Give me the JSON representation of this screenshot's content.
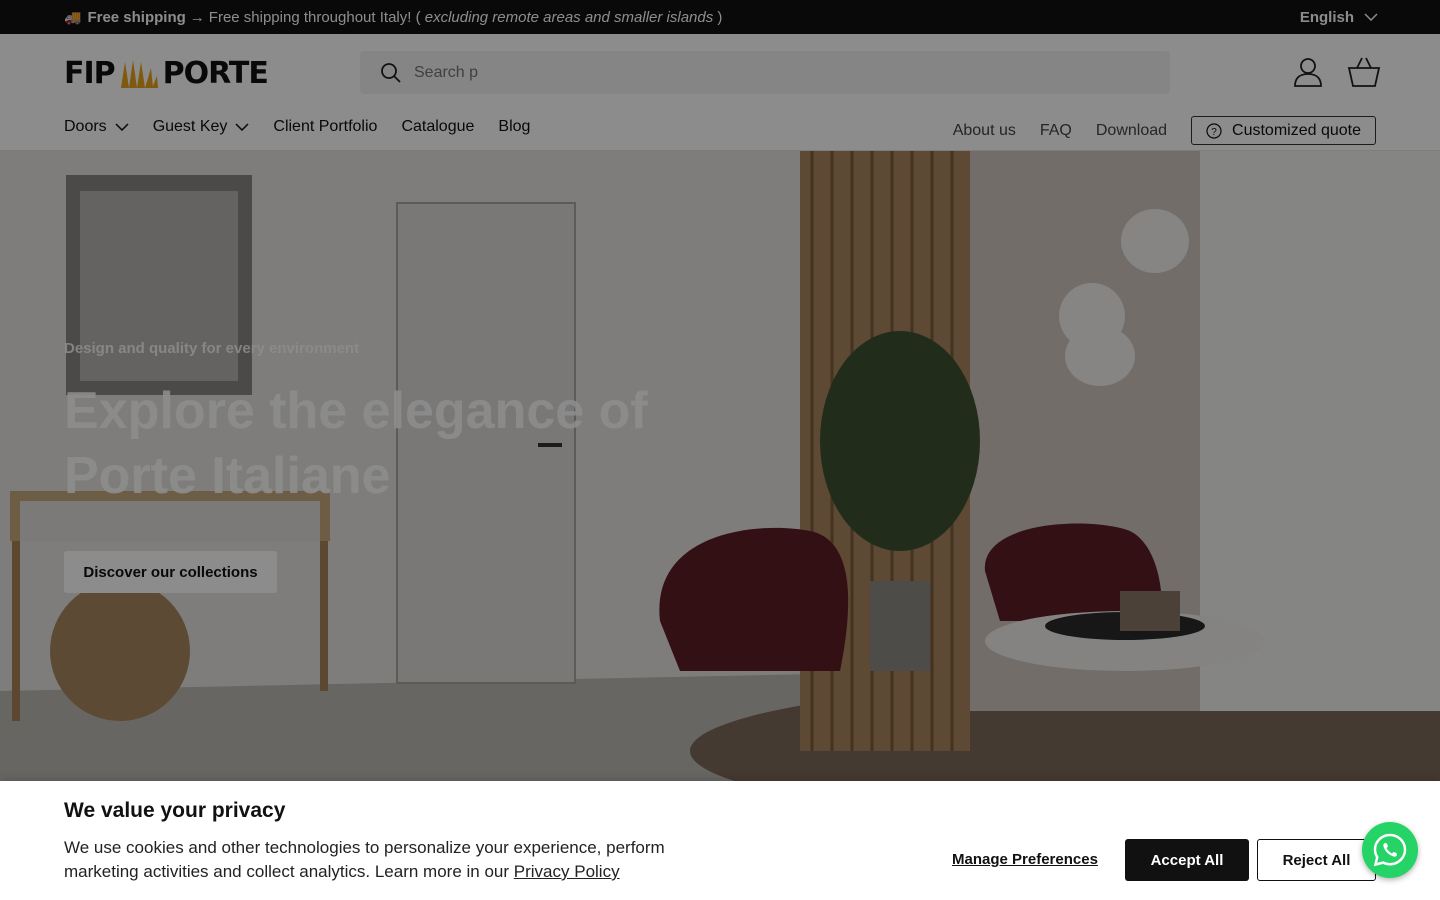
{
  "announcement": {
    "icon": "truck-icon",
    "bold": "Free shipping",
    "arrow": "→",
    "text": "Free shipping throughout Italy! (",
    "italic": "excluding remote areas and smaller islands",
    "close_paren": ")",
    "language": "English"
  },
  "header": {
    "logo_left": "FIP",
    "logo_right": "PORTE",
    "search_placeholder": "Search p",
    "nav": [
      {
        "label": "Doors",
        "has_dropdown": true
      },
      {
        "label": "Guest Key",
        "has_dropdown": true
      },
      {
        "label": "Client Portfolio",
        "has_dropdown": false
      },
      {
        "label": "Catalogue",
        "has_dropdown": false
      },
      {
        "label": "Blog",
        "has_dropdown": false
      }
    ],
    "secondary_nav": [
      "About us",
      "FAQ",
      "Download"
    ],
    "quote_button": "Customized quote"
  },
  "hero": {
    "subtitle": "Design and quality for every environment",
    "title": "Explore the elegance of Porte Italiane",
    "cta": "Discover our collections"
  },
  "cookie": {
    "title": "We value your privacy",
    "text": "We use cookies and other technologies to personalize your experience, perform marketing activities and collect analytics. Learn more in our",
    "link": "Privacy Policy",
    "manage": "Manage Preferences",
    "accept": "Accept All",
    "reject": "Reject All"
  },
  "colors": {
    "accent_dark": "#111111",
    "logo_gold": "#e8a21a",
    "whatsapp": "#25d366"
  }
}
